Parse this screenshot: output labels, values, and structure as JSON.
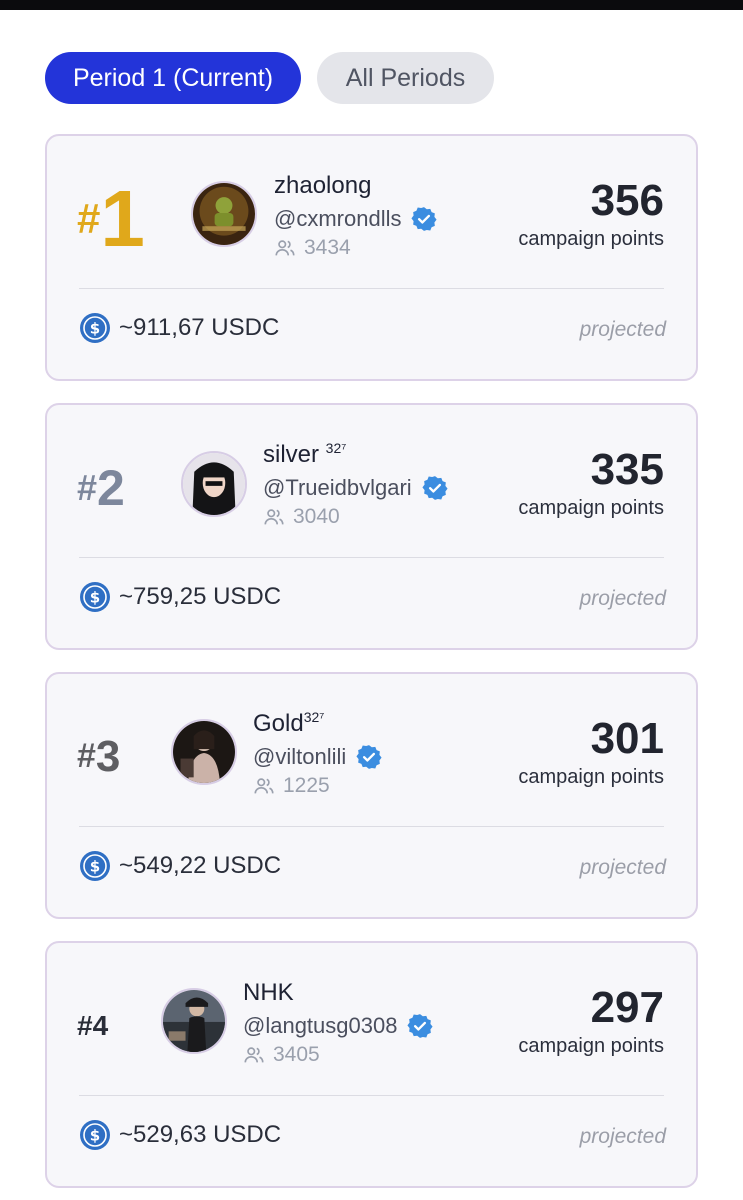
{
  "tabs": {
    "current": "Period 1 (Current)",
    "all": "All Periods"
  },
  "entries": [
    {
      "rank_hash": "#",
      "rank_num": "1",
      "name": "zhaolong",
      "name_sup": "",
      "handle": "@cxmrondlls",
      "followers": "3434",
      "points": "356",
      "points_label": "campaign points",
      "reward": "~911,67 USDC",
      "projected": "projected"
    },
    {
      "rank_hash": "#",
      "rank_num": "2",
      "name": "silver ",
      "name_sup": "32⁷",
      "handle": "@Trueidbvlgari",
      "followers": "3040",
      "points": "335",
      "points_label": "campaign points",
      "reward": "~759,25 USDC",
      "projected": "projected"
    },
    {
      "rank_hash": "#",
      "rank_num": "3",
      "name": "Gold",
      "name_sup": "32⁷",
      "handle": "@viltonlili",
      "followers": "1225",
      "points": "301",
      "points_label": "campaign points",
      "reward": "~549,22 USDC",
      "projected": "projected"
    },
    {
      "rank_hash": "#",
      "rank_num": "4",
      "name": "NHK",
      "name_sup": "",
      "handle": "@langtusg0308",
      "followers": "3405",
      "points": "297",
      "points_label": "campaign points",
      "reward": "~529,63 USDC",
      "projected": "projected"
    }
  ],
  "colors": {
    "accent": "#2334d9",
    "gold_rank": "#e0a81b",
    "silver_rank": "#7d879c",
    "bronze_rank": "#5e5e62",
    "verified": "#3b8de0",
    "usdc": "#2f6fc4"
  },
  "icons": {
    "verified": "verified-badge-icon",
    "followers": "followers-icon",
    "reward": "usdc-icon"
  }
}
